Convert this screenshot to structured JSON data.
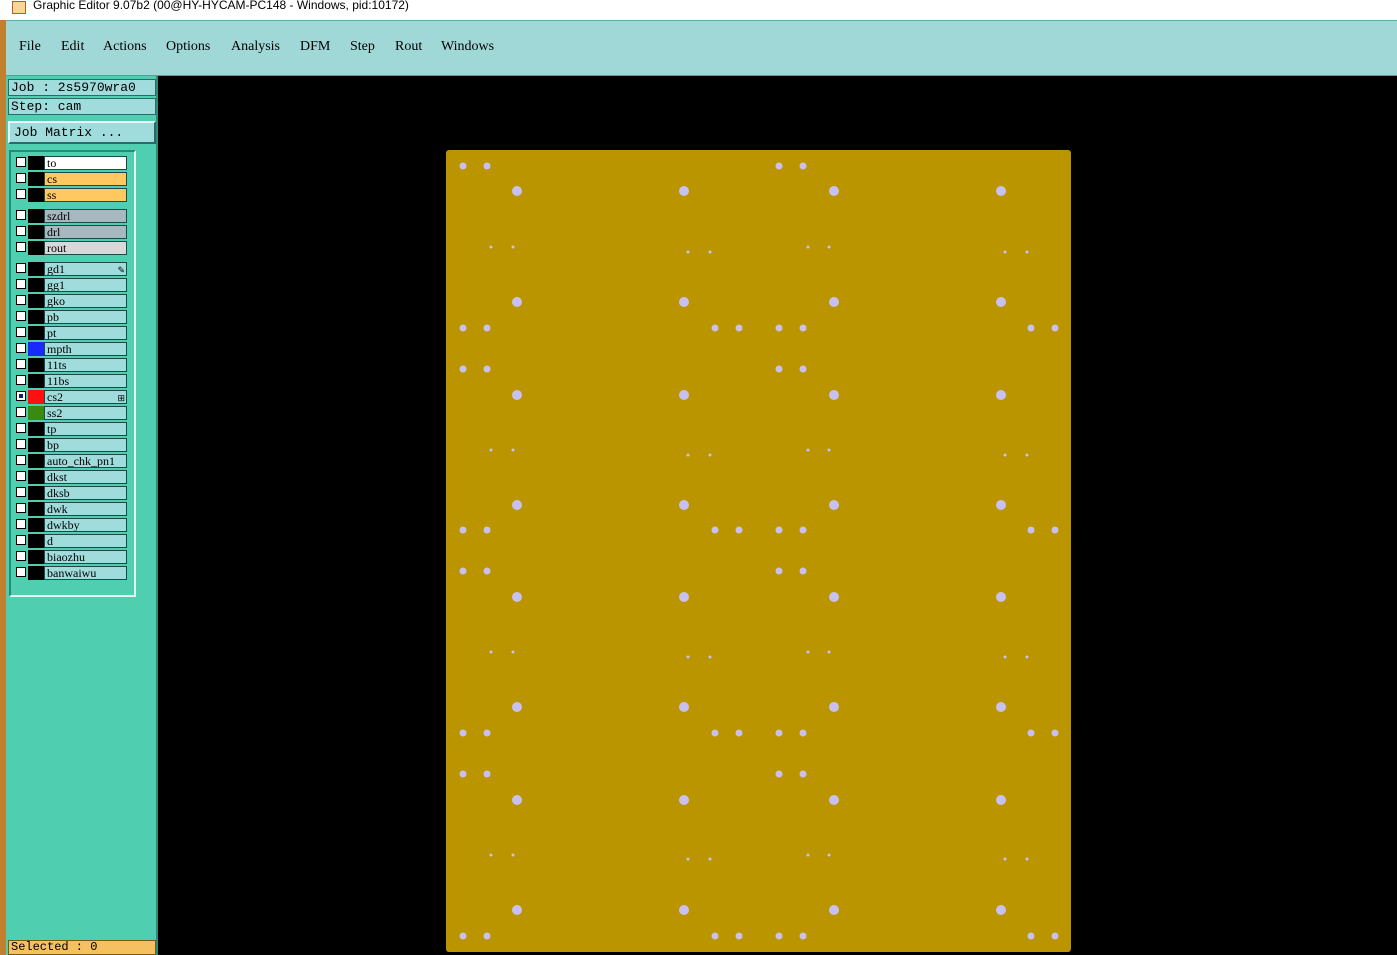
{
  "window": {
    "title": "Graphic Editor 9.07b2 (00@HY-HYCAM-PC148 - Windows, pid:10172)"
  },
  "menu": [
    "File",
    "Edit",
    "Actions",
    "Options",
    "Analysis",
    "DFM",
    "Step",
    "Rout",
    "Windows"
  ],
  "job": {
    "job_label": "Job : 2s5970wra0",
    "step_label": "Step: cam",
    "matrix_button": "Job Matrix ..."
  },
  "layers": [
    {
      "name": "to",
      "bg": "#ffffff",
      "chip": "#000000"
    },
    {
      "name": "cs",
      "bg": "#ffc860",
      "chip": "#000000"
    },
    {
      "name": "ss",
      "bg": "#ffc860",
      "chip": "#000000"
    },
    {
      "name": "szdrl",
      "bg": "#a8b8c0",
      "chip": "#000000"
    },
    {
      "name": "drl",
      "bg": "#a8b8c0",
      "chip": "#000000"
    },
    {
      "name": "rout",
      "bg": "#d8d8d8",
      "chip": "#000000"
    },
    {
      "name": "gd1",
      "bg": "#a0dcdc",
      "chip": "#000000",
      "mark": "✎"
    },
    {
      "name": "gg1",
      "bg": "#a0dcdc",
      "chip": "#000000"
    },
    {
      "name": "gko",
      "bg": "#a0dcdc",
      "chip": "#000000"
    },
    {
      "name": "pb",
      "bg": "#a0dcdc",
      "chip": "#000000"
    },
    {
      "name": "pt",
      "bg": "#a0dcdc",
      "chip": "#000000"
    },
    {
      "name": "mpth",
      "bg": "#a0dcdc",
      "chip": "#1a2aff"
    },
    {
      "name": "11ts",
      "bg": "#a0dcdc",
      "chip": "#000000"
    },
    {
      "name": "11bs",
      "bg": "#a0dcdc",
      "chip": "#000000"
    },
    {
      "name": "cs2",
      "bg": "#a0dcdc",
      "chip": "#ff1010",
      "checked": true,
      "mark": "⊞"
    },
    {
      "name": "ss2",
      "bg": "#a0dcdc",
      "chip": "#3a8a10"
    },
    {
      "name": "tp",
      "bg": "#a0dcdc",
      "chip": "#000000"
    },
    {
      "name": "bp",
      "bg": "#a0dcdc",
      "chip": "#000000"
    },
    {
      "name": "auto_chk_pn1",
      "bg": "#a0dcdc",
      "chip": "#000000"
    },
    {
      "name": "dkst",
      "bg": "#a0dcdc",
      "chip": "#000000"
    },
    {
      "name": "dksb",
      "bg": "#a0dcdc",
      "chip": "#000000"
    },
    {
      "name": "dwk",
      "bg": "#a0dcdc",
      "chip": "#000000"
    },
    {
      "name": "dwkby",
      "bg": "#a0dcdc",
      "chip": "#000000"
    },
    {
      "name": "d",
      "bg": "#a0dcdc",
      "chip": "#000000"
    },
    {
      "name": "biaozhu",
      "bg": "#a0dcdc",
      "chip": "#000000"
    },
    {
      "name": "banwaiwu",
      "bg": "#a0dcdc",
      "chip": "#000000"
    }
  ],
  "status": {
    "selected": "Selected : 0"
  },
  "colors": {
    "board": "#bb9500",
    "pad": "#c8c0f0",
    "canvas": "#000000"
  }
}
